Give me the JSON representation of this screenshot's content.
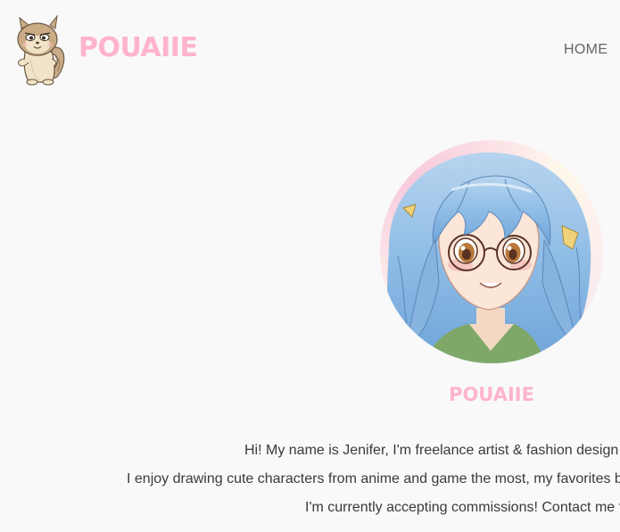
{
  "header": {
    "logo_text": "POUAIIE",
    "nav": {
      "home_label": "HOME"
    }
  },
  "profile": {
    "name": "POUAIIE",
    "bio": [
      "Hi! My name is Jenifer, I'm freelance artist & fashion design m",
      "I enjoy drawing cute characters from anime and game the most, my favorites bei",
      "I'm currently accepting commissions! Contact me fo"
    ]
  },
  "colors": {
    "background": "#f9f9f9",
    "brand_pink": "#ffb3cf",
    "nav_text": "#666666",
    "body_text": "#3a3a3a"
  },
  "icons": {
    "logo_mascot": "squirrel-mascot-icon",
    "avatar": "anime-girl-avatar"
  }
}
